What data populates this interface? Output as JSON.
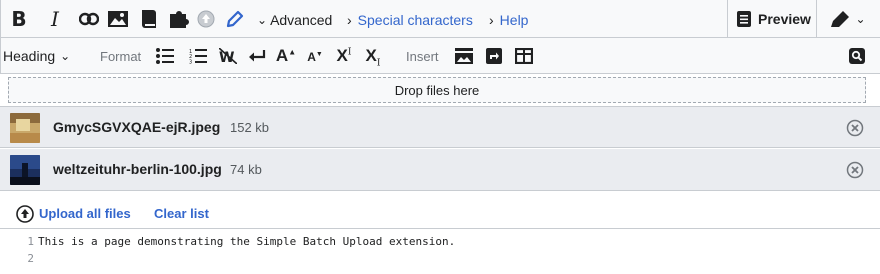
{
  "toolbar": {
    "advanced_label": "Advanced",
    "special_characters_label": "Special characters",
    "help_label": "Help",
    "preview_label": "Preview",
    "heading_label": "Heading",
    "format_label": "Format",
    "insert_label": "Insert",
    "superscript_sup": "I",
    "subscript_sub": "I"
  },
  "dropzone": {
    "label": "Drop files here"
  },
  "files": [
    {
      "name": "GmycSGVXQAE-ejR.jpeg",
      "size": "152 kb"
    },
    {
      "name": "weltzeituhr-berlin-100.jpg",
      "size": "74 kb"
    }
  ],
  "actions": {
    "upload_all_label": "Upload all files",
    "clear_list_label": "Clear list"
  },
  "editor": {
    "lines": [
      {
        "number": "1",
        "text": "This is a page demonstrating the Simple Batch Upload extension."
      },
      {
        "number": "2",
        "text": ""
      }
    ]
  },
  "colors": {
    "link": "#3366cc",
    "toolbar_bg": "#f8f9fa",
    "file_row_bg": "#eaecf0",
    "active_icon": "#3366cc"
  }
}
